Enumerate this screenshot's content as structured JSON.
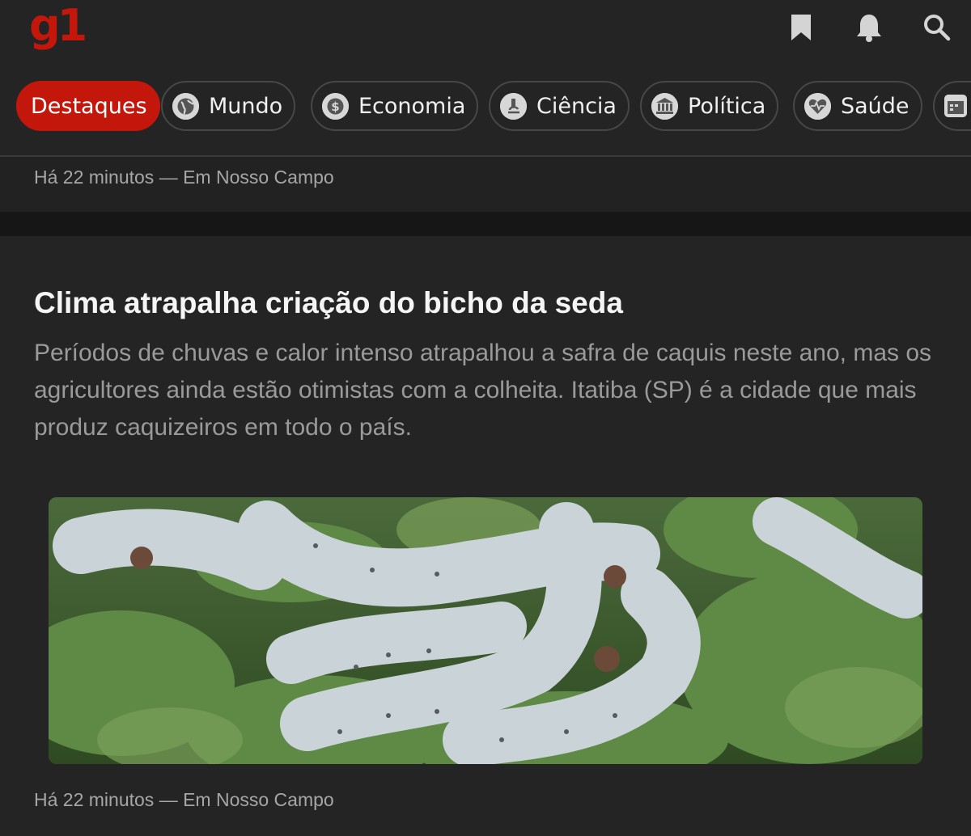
{
  "header": {
    "logo": "g1",
    "icons": [
      "bookmark-icon",
      "bell-icon",
      "search-icon"
    ]
  },
  "tabs": [
    {
      "label": "Destaques",
      "icon": null,
      "active": true
    },
    {
      "label": "Mundo",
      "icon": "globe-icon"
    },
    {
      "label": "Economia",
      "icon": "dollar-icon"
    },
    {
      "label": "Ciência",
      "icon": "microscope-icon"
    },
    {
      "label": "Política",
      "icon": "government-building-icon"
    },
    {
      "label": "Saúde",
      "icon": "heart-pulse-icon"
    },
    {
      "label": "",
      "icon": "calendar-icon"
    }
  ],
  "previous_item": {
    "meta": "Há 22 minutos — Em Nosso Campo"
  },
  "article": {
    "title": "Clima atrapalha criação do bicho da seda",
    "summary": "Períodos de chuvas e calor intenso atrapalhou a safra de caquis neste ano, mas os agricultores ainda estão otimistas com a colheita. Itatiba (SP) é a cidade que mais produz caquizeiros em todo o país.",
    "image": "silkworms-on-mulberry-leaves",
    "meta": "Há 22 minutos — Em Nosso Campo"
  },
  "colors": {
    "accent": "#c4170c",
    "background": "#242424",
    "separator": "#161616"
  }
}
